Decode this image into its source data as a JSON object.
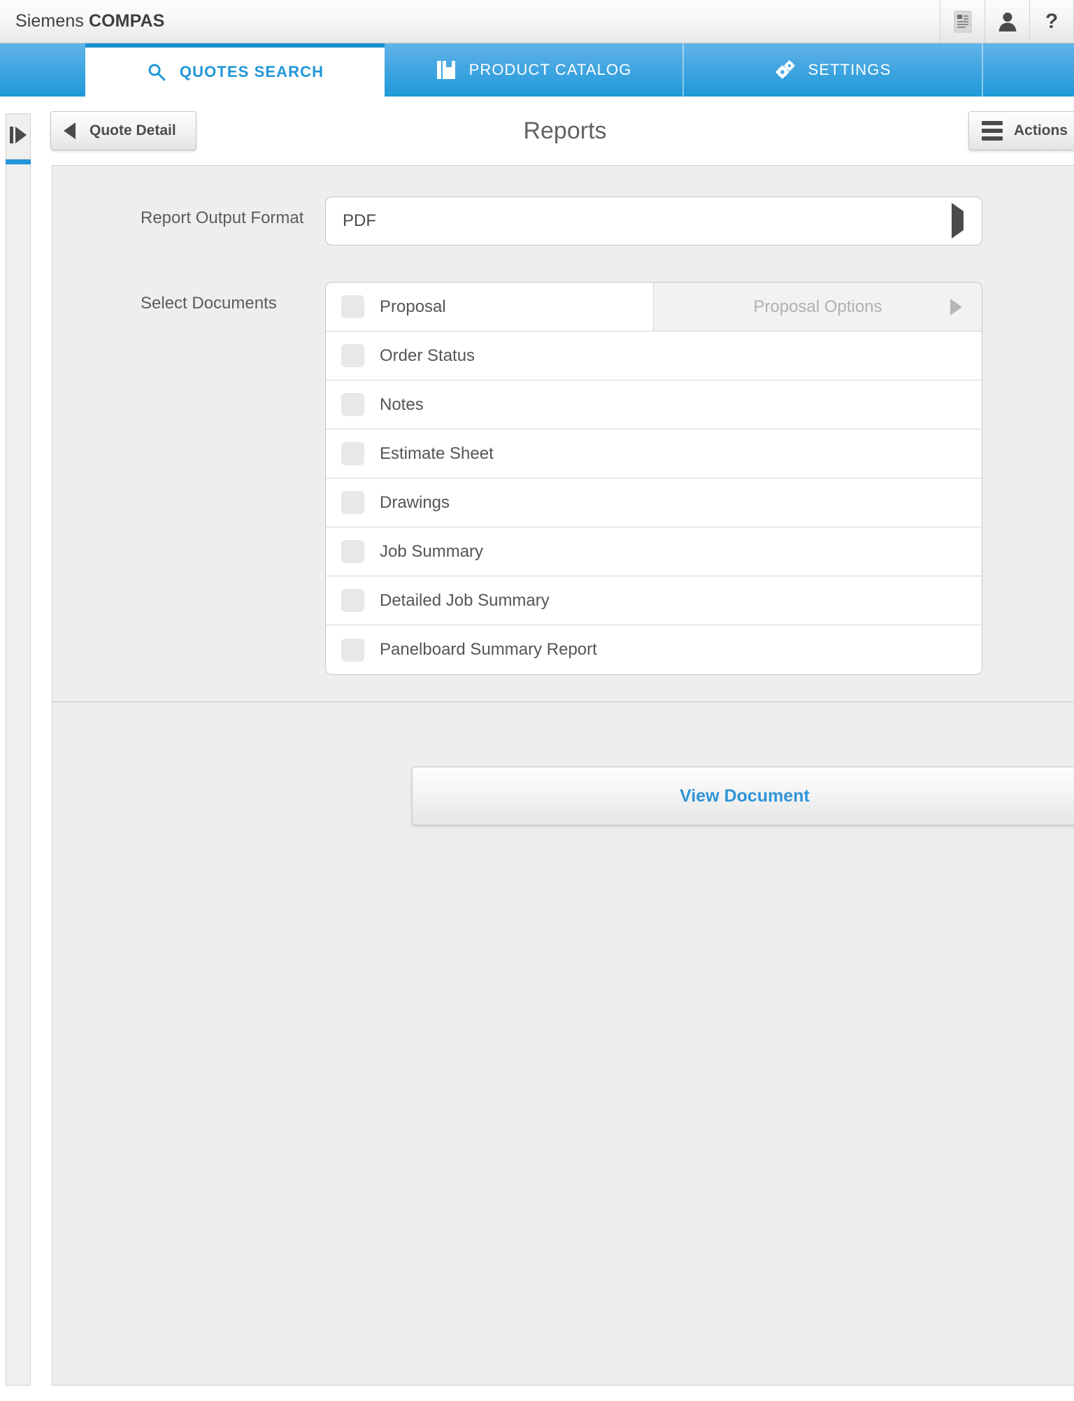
{
  "app": {
    "brand_light": "Siemens",
    "brand_bold": "COMPAS",
    "header_icons": [
      {
        "name": "document-icon",
        "label": "Document"
      },
      {
        "name": "user-icon",
        "label": "User"
      },
      {
        "name": "help-icon",
        "label": "?"
      }
    ]
  },
  "tabs": [
    {
      "label": "QUOTES SEARCH",
      "icon": "search-icon",
      "active": true
    },
    {
      "label": "PRODUCT CATALOG",
      "icon": "book-icon",
      "active": false
    },
    {
      "label": "SETTINGS",
      "icon": "gears-icon",
      "active": false
    }
  ],
  "toolbar": {
    "back_label": "Quote Detail",
    "title": "Reports",
    "actions_label": "Actions"
  },
  "form": {
    "output_format_label": "Report Output Format",
    "output_format_value": "PDF",
    "select_documents_label": "Select Documents",
    "proposal_options_label": "Proposal Options"
  },
  "documents": [
    {
      "label": "Proposal",
      "checked": false,
      "has_options": true
    },
    {
      "label": "Order Status",
      "checked": false,
      "has_options": false
    },
    {
      "label": "Notes",
      "checked": false,
      "has_options": false
    },
    {
      "label": "Estimate Sheet",
      "checked": false,
      "has_options": false
    },
    {
      "label": "Drawings",
      "checked": false,
      "has_options": false
    },
    {
      "label": "Job Summary",
      "checked": false,
      "has_options": false
    },
    {
      "label": "Detailed Job Summary",
      "checked": false,
      "has_options": false
    },
    {
      "label": "Panelboard Summary Report",
      "checked": false,
      "has_options": false
    }
  ],
  "footer": {
    "view_document_label": "View Document"
  },
  "colors": {
    "accent_blue": "#2196d8",
    "tab_bar_top": "#63b4e8",
    "tab_bar_bottom": "#1f9ad8",
    "panel_bg": "#eeeeee",
    "text_gray": "#555555"
  }
}
